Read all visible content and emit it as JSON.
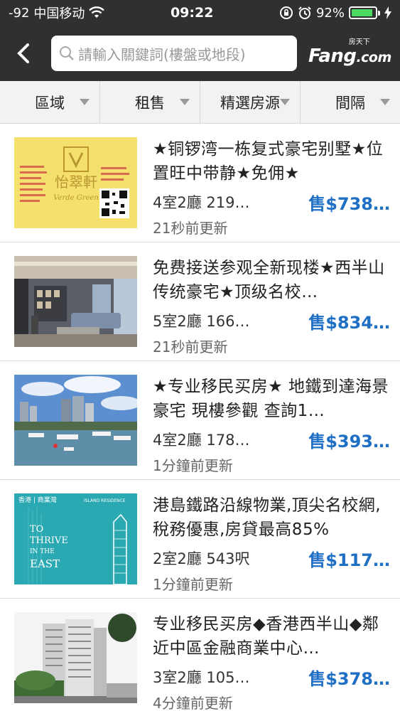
{
  "status_bar": {
    "signal": "-92",
    "carrier": "中国移动",
    "time": "09:22",
    "battery": "92%",
    "battery_level": 0.92
  },
  "nav": {
    "search_placeholder": "請輸入關鍵詞(樓盤或地段)",
    "logo_small": "房天下",
    "logo_main": "Fang",
    "logo_suffix": ".com"
  },
  "filters": [
    "區域",
    "租售",
    "精選房源",
    "間隔"
  ],
  "listings": [
    {
      "title": "★铜锣湾一栋复式豪宅别墅★位置旺中带静★免佣★",
      "spec": "4室2廳  219…",
      "price": "售$738…",
      "updated": "21秒前更新",
      "thumb": "logo-card"
    },
    {
      "title": "免费接送参观全新现楼★西半山传统豪宅★顶级名校…",
      "spec": "5室2廳  166…",
      "price": "售$834…",
      "updated": "21秒前更新",
      "thumb": "living-room"
    },
    {
      "title": "★专业移民买房★ 地鐵到達海景豪宅 現樓參觀 查詢1…",
      "spec": "4室2廳  178…",
      "price": "售$393…",
      "updated": "1分鐘前更新",
      "thumb": "harbour"
    },
    {
      "title": "港島鐵路沿線物業,頂尖名校網,稅務優惠,房貸最高85%",
      "spec": "2室2廳  543呎",
      "price": "售$117…",
      "updated": "1分鐘前更新",
      "thumb": "teal-poster"
    },
    {
      "title": "专业移民买房◆香港西半山◆鄰近中區金融商業中心…",
      "spec": "3室2廳  105…",
      "price": "售$378…",
      "updated": "4分鐘前更新",
      "thumb": "tower"
    }
  ],
  "thumb_text": {
    "logo_card_cn": "怡翠軒",
    "logo_card_en": "Verde Green",
    "poster_tag": "香港 | 商業灣",
    "poster_brand": "ISLAND RESIDENCE",
    "poster_line1": "TO",
    "poster_line2": "THRIVE",
    "poster_line3": "IN THE",
    "poster_line4": "EAST"
  },
  "colors": {
    "accent": "#1f6fc5",
    "header": "#2f3032",
    "battery": "#4cd964"
  }
}
